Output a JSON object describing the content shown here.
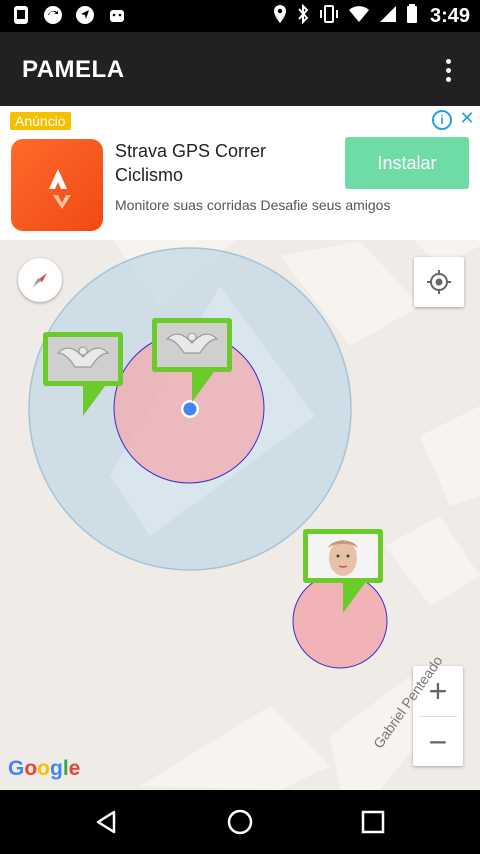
{
  "status_bar": {
    "time": "3:49",
    "left_icons": [
      "vibration-icon",
      "sync-icon",
      "navigation-icon",
      "android-icon"
    ],
    "right_icons": [
      "location-icon",
      "bluetooth-icon",
      "vibrate-icon",
      "wifi-icon",
      "signal-icon",
      "battery-icon"
    ]
  },
  "app_bar": {
    "title": "PAMELA",
    "menu_icon": "more-vert-icon"
  },
  "ad": {
    "badge": "Anúncio",
    "title": "Strava GPS Correr Ciclismo",
    "description": "Monitore suas corridas Desafie seus amigos",
    "install_label": "Instalar",
    "info_icon": "i",
    "close_icon": "✕",
    "colors": {
      "install_bg": "#6fdca6",
      "badge_bg": "#f5c000",
      "logo_bg": "#f04a12"
    }
  },
  "map": {
    "google_logo": "Google",
    "street_label": "Gabriel Penteado",
    "zoom_in": "+",
    "zoom_out": "−",
    "colors": {
      "background": "#efebe6",
      "accuracy_circle": "#b9d3e6",
      "geofence": "#f4a3a8",
      "marker_frame": "#6bcb2b",
      "user_dot": "#4285f4"
    }
  },
  "nav_bar": {
    "back": "back-icon",
    "home": "home-icon",
    "recents": "recents-icon"
  }
}
